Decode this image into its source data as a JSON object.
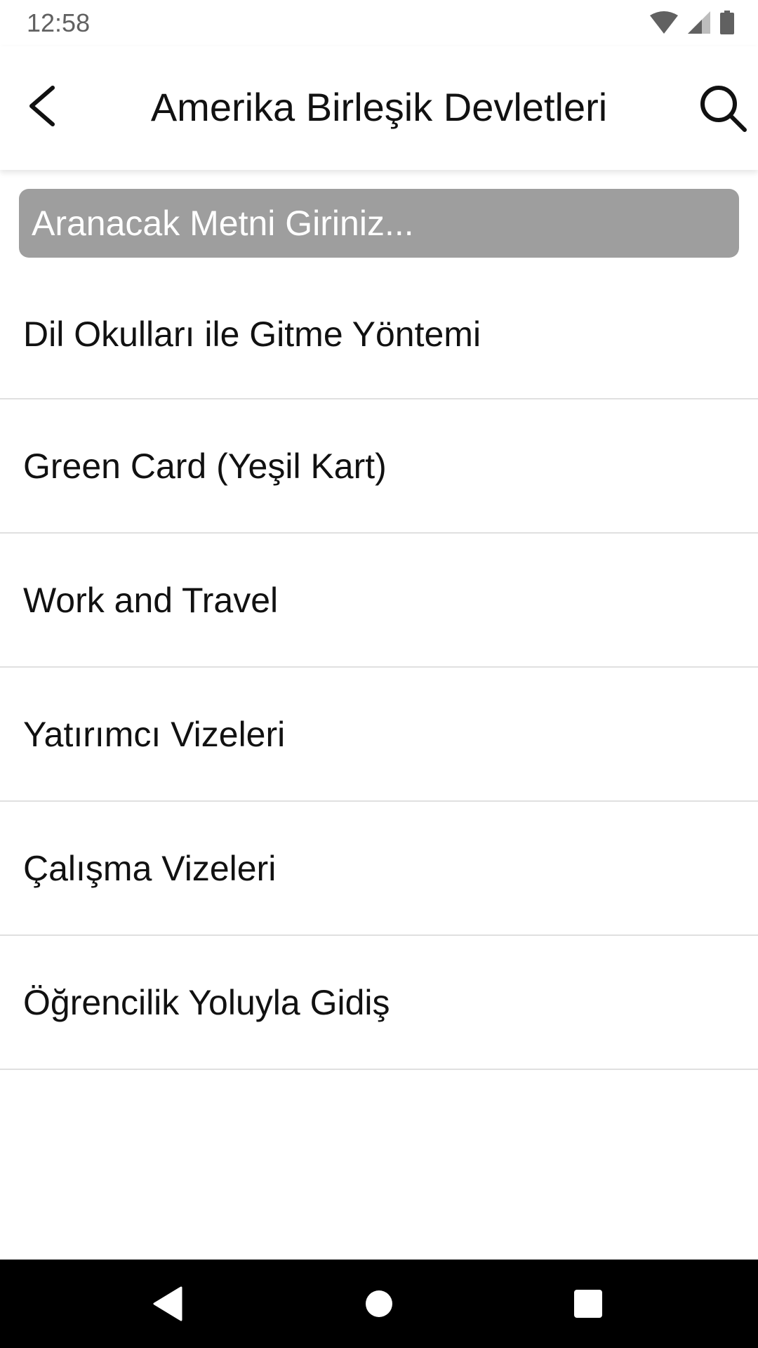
{
  "status_bar": {
    "time": "12:58",
    "icons": [
      "wifi-icon",
      "cell-signal-icon",
      "battery-icon"
    ]
  },
  "app_bar": {
    "title": "Amerika Birleşik Devletleri",
    "back_icon": "back-arrow-icon",
    "search_icon": "search-icon"
  },
  "search": {
    "placeholder": "Aranacak Metni Giriniz...",
    "value": ""
  },
  "list": {
    "items": [
      {
        "label": "Dil Okulları ile Gitme Yöntemi"
      },
      {
        "label": "Green Card (Yeşil Kart)"
      },
      {
        "label": "Work and Travel"
      },
      {
        "label": "Yatırımcı Vizeleri"
      },
      {
        "label": "Çalışma Vizeleri"
      },
      {
        "label": "Öğrencilik Yoluyla Gidiş"
      }
    ]
  },
  "nav_bar": {
    "icons": [
      "nav-back-icon",
      "nav-home-icon",
      "nav-recents-icon"
    ]
  },
  "colors": {
    "search_field_bg": "#9e9e9e",
    "divider": "#e0e0e0",
    "nav_bar_bg": "#000000"
  }
}
